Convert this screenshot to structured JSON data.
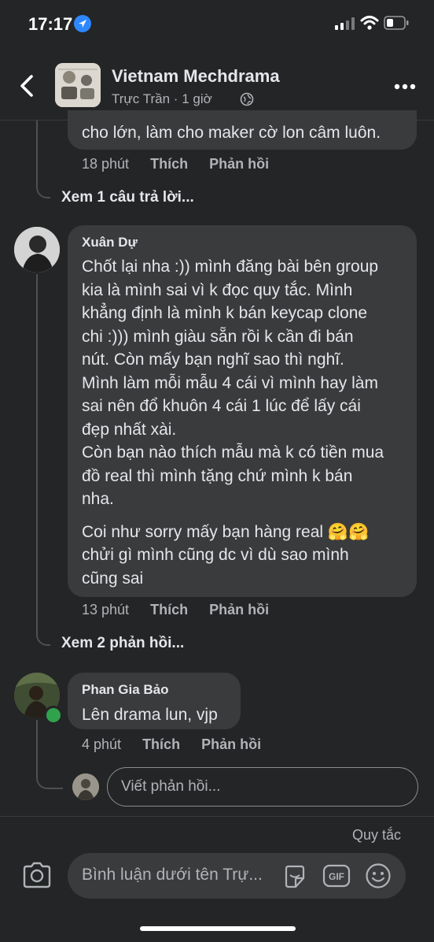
{
  "status_bar": {
    "time": "17:17"
  },
  "header": {
    "group_name": "Vietnam Mechdrama",
    "author": "Trực Trần",
    "separator": "·",
    "time": "1 giờ",
    "globe_icon": "globe-icon"
  },
  "comments": [
    {
      "text_tail": "cho lớn, làm cho maker cờ lon câm luôn.",
      "time": "18 phút",
      "like": "Thích",
      "reply": "Phản hồi",
      "view_replies": "Xem 1 câu trả lời..."
    },
    {
      "author": "Xuân Dự",
      "lines": [
        "Chốt lại nha :)) mình đăng bài bên group",
        "kia là mình sai vì k đọc quy tắc. Mình",
        "khẳng định là mình k bán keycap clone",
        "chi :))) mình giàu sẵn rồi k cần đi bán",
        "nút. Còn mấy bạn nghĩ sao thì nghĩ.",
        "Mình làm mỗi mẫu 4 cái vì mình hay làm",
        "sai nên đổ khuôn 4 cái 1 lúc để lấy cái",
        "đẹp nhất xài.",
        "Còn bạn nào thích mẫu mà k có tiền mua",
        "đồ real thì mình tặng chứ mình k bán",
        "nha."
      ],
      "lines2": [
        "Coi như sorry mấy bạn hàng real 🤗🤗",
        "chửi gì mình cũng dc vì dù sao mình",
        "cũng sai"
      ],
      "time": "13 phút",
      "like": "Thích",
      "reply": "Phản hồi",
      "view_replies": "Xem 2 phản hồi..."
    },
    {
      "author": "Phan Gia Bảo",
      "text": "Lên drama lun, vjp",
      "time": "4 phút",
      "like": "Thích",
      "reply": "Phản hồi",
      "online_color": "#31a24c"
    }
  ],
  "reply_input": {
    "placeholder": "Viết phản hồi..."
  },
  "bottom_bar": {
    "rules": "Quy tắc",
    "placeholder": "Bình luận dưới tên Trự...",
    "gif_label": "GIF"
  },
  "colors": {
    "background": "#242526",
    "bubble": "#3a3b3c",
    "text": "#e4e6eb",
    "muted": "#b0b3b8",
    "accent": "#2d88ff"
  }
}
